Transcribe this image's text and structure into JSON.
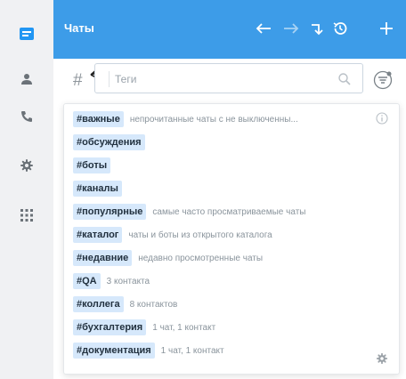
{
  "header": {
    "title": "Чаты"
  },
  "search": {
    "hash_symbol": "#",
    "placeholder": "Теги"
  },
  "tags": [
    {
      "tag": "#важные",
      "desc": "непрочитанные чаты с не выключенны..."
    },
    {
      "tag": "#обсуждения",
      "desc": ""
    },
    {
      "tag": "#боты",
      "desc": ""
    },
    {
      "tag": "#каналы",
      "desc": ""
    },
    {
      "tag": "#популярные",
      "desc": "самые часто просматриваемые чаты"
    },
    {
      "tag": "#каталог",
      "desc": "чаты и боты из открытого каталога"
    },
    {
      "tag": "#недавние",
      "desc": "недавно просмотренные чаты"
    },
    {
      "tag": "#QA",
      "desc": "3 контакта"
    },
    {
      "tag": "#коллега",
      "desc": "8 контактов"
    },
    {
      "tag": "#бухгалтерия",
      "desc": "1 чат, 1 контакт"
    },
    {
      "tag": "#документация",
      "desc": "1 чат, 1 контакт"
    }
  ],
  "colors": {
    "header": "#3d9ce8",
    "rail": "#f0f1f3",
    "tag_bg": "#d6e8fb",
    "accent": "#2196f3"
  },
  "icons": {
    "rail": [
      "chat-icon",
      "contacts-icon",
      "phone-icon",
      "settings-icon",
      "apps-grid-icon"
    ],
    "header": [
      "back-arrow-icon",
      "forward-arrow-icon",
      "jump-icon",
      "history-icon",
      "add-icon"
    ]
  }
}
